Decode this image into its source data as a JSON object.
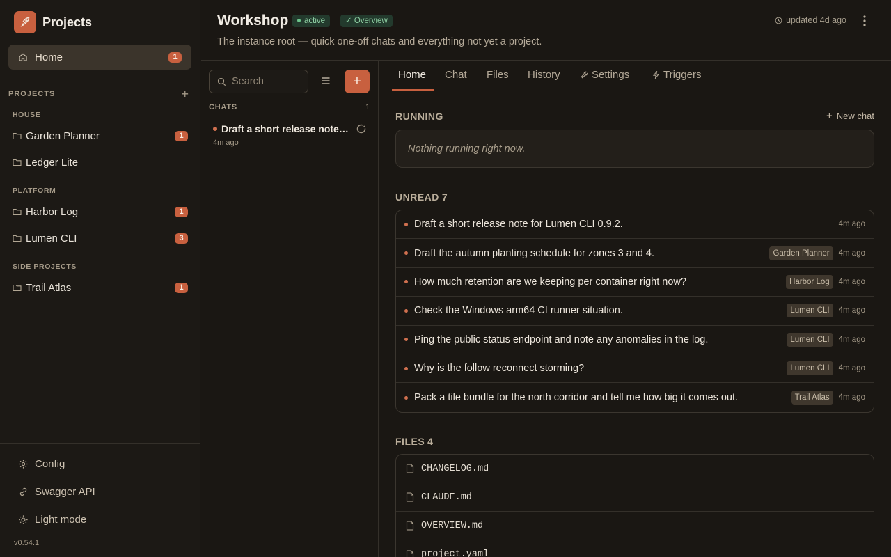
{
  "brand": {
    "title": "Projects"
  },
  "sidebar": {
    "home": {
      "label": "Home",
      "badge": "1"
    },
    "projects_header": "PROJECTS",
    "groups": [
      {
        "label": "HOUSE",
        "items": [
          {
            "label": "Garden Planner",
            "badge": "1"
          },
          {
            "label": "Ledger Lite",
            "badge": ""
          }
        ]
      },
      {
        "label": "PLATFORM",
        "items": [
          {
            "label": "Harbor Log",
            "badge": "1"
          },
          {
            "label": "Lumen CLI",
            "badge": "3"
          }
        ]
      },
      {
        "label": "SIDE PROJECTS",
        "items": [
          {
            "label": "Trail Atlas",
            "badge": "1"
          }
        ]
      }
    ],
    "footer": {
      "config": "Config",
      "swagger": "Swagger API",
      "light_mode": "Light mode",
      "version": "v0.54.1"
    }
  },
  "header": {
    "title": "Workshop",
    "status": "active",
    "overview": "✓ Overview",
    "subtitle": "The instance root — quick one-off chats and everything not yet a project.",
    "updated": "updated 4d ago"
  },
  "chatlist": {
    "search_placeholder": "Search",
    "section": "CHATS",
    "count": "1",
    "chats": [
      {
        "title": "Draft a short release note for Lumen CLI 0.9.2.",
        "time": "4m ago"
      }
    ]
  },
  "tabs": [
    {
      "label": "Home"
    },
    {
      "label": "Chat"
    },
    {
      "label": "Files"
    },
    {
      "label": "History"
    },
    {
      "label": "Settings"
    },
    {
      "label": "Triggers"
    }
  ],
  "running": {
    "title": "RUNNING",
    "new_chat": "New chat",
    "empty": "Nothing running right now."
  },
  "unread": {
    "title": "UNREAD",
    "count": "7",
    "items": [
      {
        "text": "Draft a short release note for Lumen CLI 0.9.2.",
        "tag": "",
        "time": "4m ago"
      },
      {
        "text": "Draft the autumn planting schedule for zones 3 and 4.",
        "tag": "Garden Planner",
        "time": "4m ago"
      },
      {
        "text": "How much retention are we keeping per container right now?",
        "tag": "Harbor Log",
        "time": "4m ago"
      },
      {
        "text": "Check the Windows arm64 CI runner situation.",
        "tag": "Lumen CLI",
        "time": "4m ago"
      },
      {
        "text": "Ping the public status endpoint and note any anomalies in the log.",
        "tag": "Lumen CLI",
        "time": "4m ago"
      },
      {
        "text": "Why is the follow reconnect storming?",
        "tag": "Lumen CLI",
        "time": "4m ago"
      },
      {
        "text": "Pack a tile bundle for the north corridor and tell me how big it comes out.",
        "tag": "Trail Atlas",
        "time": "4m ago"
      }
    ]
  },
  "files": {
    "title": "FILES",
    "count": "4",
    "items": [
      {
        "name": "CHANGELOG.md"
      },
      {
        "name": "CLAUDE.md"
      },
      {
        "name": "OVERVIEW.md"
      },
      {
        "name": "project.yaml"
      }
    ]
  },
  "colors": {
    "accent": "#c8603f",
    "background": "#1a1713",
    "status_green": "#6cc48b"
  }
}
